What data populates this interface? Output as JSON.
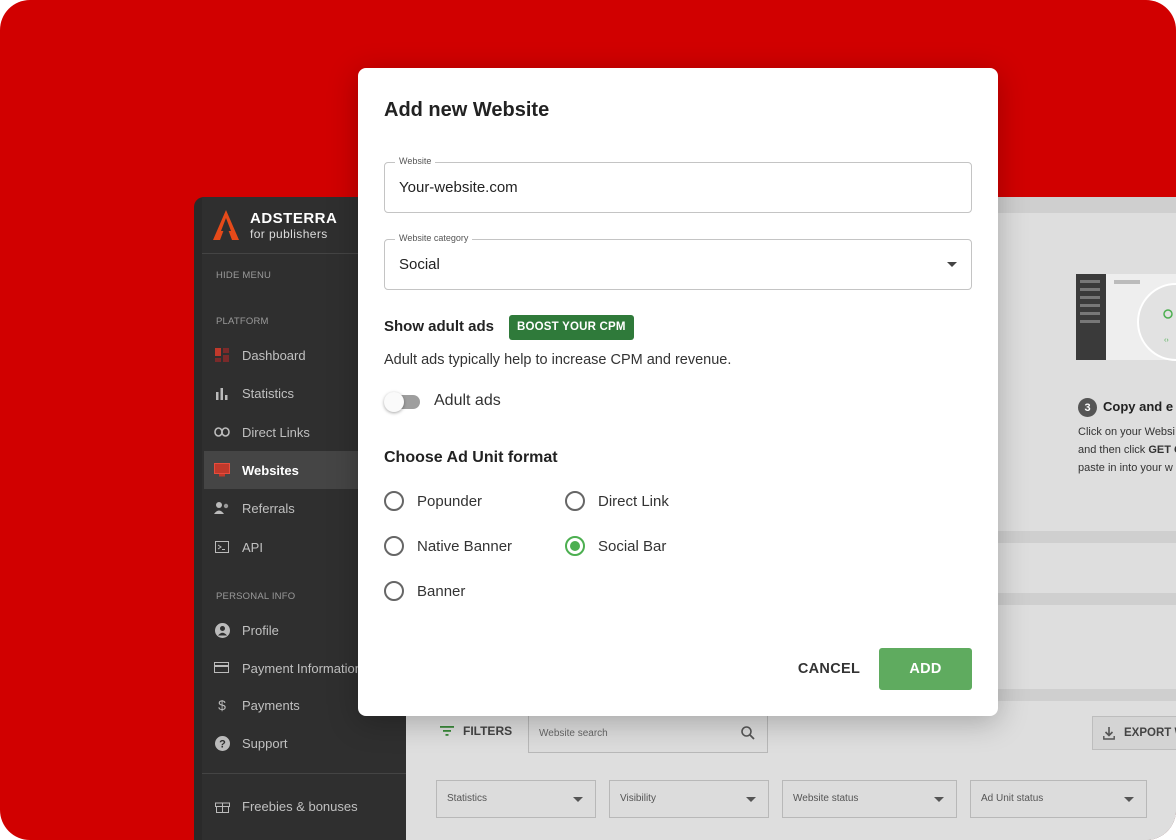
{
  "brand": {
    "name": "ADSTERRA",
    "sub": "for publishers"
  },
  "sidebar": {
    "hide_menu": "HIDE MENU",
    "platform_label": "PLATFORM",
    "platform_items": [
      {
        "label": "Dashboard",
        "icon": "dashboard-icon"
      },
      {
        "label": "Statistics",
        "icon": "bar-chart-icon"
      },
      {
        "label": "Direct Links",
        "icon": "link-icon"
      },
      {
        "label": "Websites",
        "icon": "monitor-icon",
        "active": true
      },
      {
        "label": "Referrals",
        "icon": "people-icon"
      },
      {
        "label": "API",
        "icon": "terminal-icon"
      }
    ],
    "personal_label": "PERSONAL INFO",
    "personal_items": [
      {
        "label": "Profile",
        "icon": "user-icon"
      },
      {
        "label": "Payment Information",
        "icon": "card-icon"
      },
      {
        "label": "Payments",
        "icon": "dollar-icon"
      },
      {
        "label": "Support",
        "icon": "help-icon"
      }
    ],
    "freebies": "Freebies & bonuses"
  },
  "main": {
    "promo_step": "3",
    "promo_title": "Copy and e",
    "promo_line1": "Click on your Websi",
    "promo_line2a": "and then click ",
    "promo_line2b": "GET C",
    "promo_line3": "paste in into your w",
    "filters_label": "FILTERS",
    "search_placeholder": "Website search",
    "export_label": "EXPORT W",
    "selects": [
      "Statistics",
      "Visibility",
      "Website status",
      "Ad Unit status"
    ]
  },
  "modal": {
    "title": "Add new Website",
    "website_label": "Website",
    "website_value": "Your-website.com",
    "category_label": "Website category",
    "category_value": "Social",
    "adult_title": "Show adult ads",
    "boost_badge": "BOOST YOUR CPM",
    "adult_desc": "Adult ads typically help to increase CPM and revenue.",
    "adult_toggle_label": "Adult ads",
    "adult_toggle_on": false,
    "format_title": "Choose Ad Unit format",
    "formats": [
      {
        "label": "Popunder",
        "checked": false
      },
      {
        "label": "Direct Link",
        "checked": false
      },
      {
        "label": "Native Banner",
        "checked": false
      },
      {
        "label": "Social Bar",
        "checked": true
      },
      {
        "label": "Banner",
        "checked": false
      }
    ],
    "cancel_label": "CANCEL",
    "add_label": "ADD"
  },
  "colors": {
    "background": "#d10000",
    "accent_green": "#5fab5f",
    "badge_green": "#2f7a3a",
    "sidebar": "#2f2f2f"
  }
}
